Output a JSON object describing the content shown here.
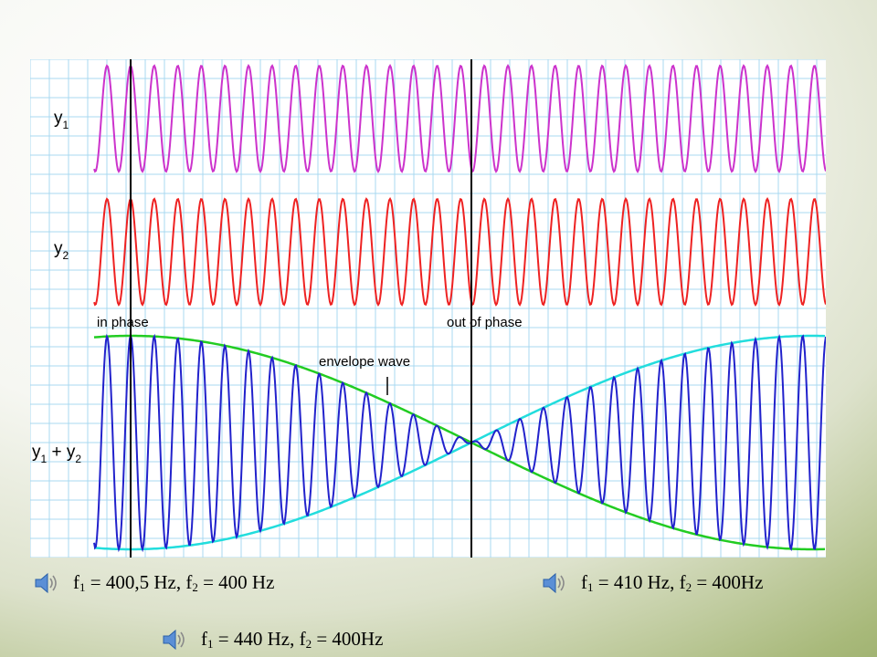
{
  "diagram": {
    "labels": {
      "y1": {
        "base": "y",
        "sub": "1"
      },
      "y2": {
        "base": "y",
        "sub": "2"
      },
      "sum": {
        "base1": "y",
        "sub1": "1",
        "plus": " + ",
        "base2": "y",
        "sub2": "2"
      },
      "in_phase": "in phase",
      "out_of_phase": "out of phase",
      "envelope_wave": "envelope wave"
    },
    "colors": {
      "y1": "#cc33cc",
      "y2": "#ee2222",
      "sum": "#2222cc",
      "envelope_green": "#22cc22",
      "envelope_cyan": "#22dddd",
      "grid": "#a8d8f0",
      "marker": "#000000"
    },
    "wave": {
      "cycles": 32
    }
  },
  "sounds": [
    {
      "f1_label": "f",
      "f1_sub": "1",
      "f1_value": " = 400,5 Hz, ",
      "f2_label": "f",
      "f2_sub": "2",
      "f2_value": " = 400 Hz",
      "icon": "speaker-icon"
    },
    {
      "f1_label": "f",
      "f1_sub": "1",
      "f1_value": " = 410 Hz, ",
      "f2_label": "f",
      "f2_sub": "2",
      "f2_value": " = 400Hz",
      "icon": "speaker-icon"
    },
    {
      "f1_label": "f",
      "f1_sub": "1",
      "f1_value": " = 440 Hz, ",
      "f2_label": "f",
      "f2_sub": "2",
      "f2_value": " = 400Hz",
      "icon": "speaker-icon"
    }
  ]
}
